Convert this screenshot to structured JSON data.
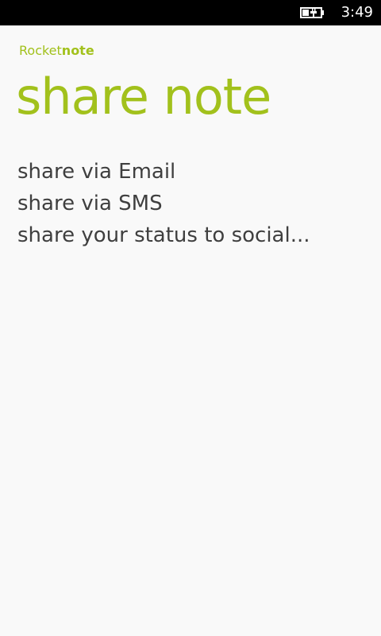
{
  "status_bar": {
    "time": "3:49",
    "battery_icon": "battery-charging-icon"
  },
  "header": {
    "app_name_regular": "Rocket",
    "app_name_bold": "note",
    "page_title": "share note"
  },
  "menu": {
    "items": [
      {
        "label": "share via Email"
      },
      {
        "label": "share via SMS"
      },
      {
        "label": "share your status to social..."
      }
    ]
  },
  "colors": {
    "accent": "#a2c11c",
    "text": "#3f3f3f",
    "background": "#f9f9f9",
    "status_bar": "#000000"
  }
}
